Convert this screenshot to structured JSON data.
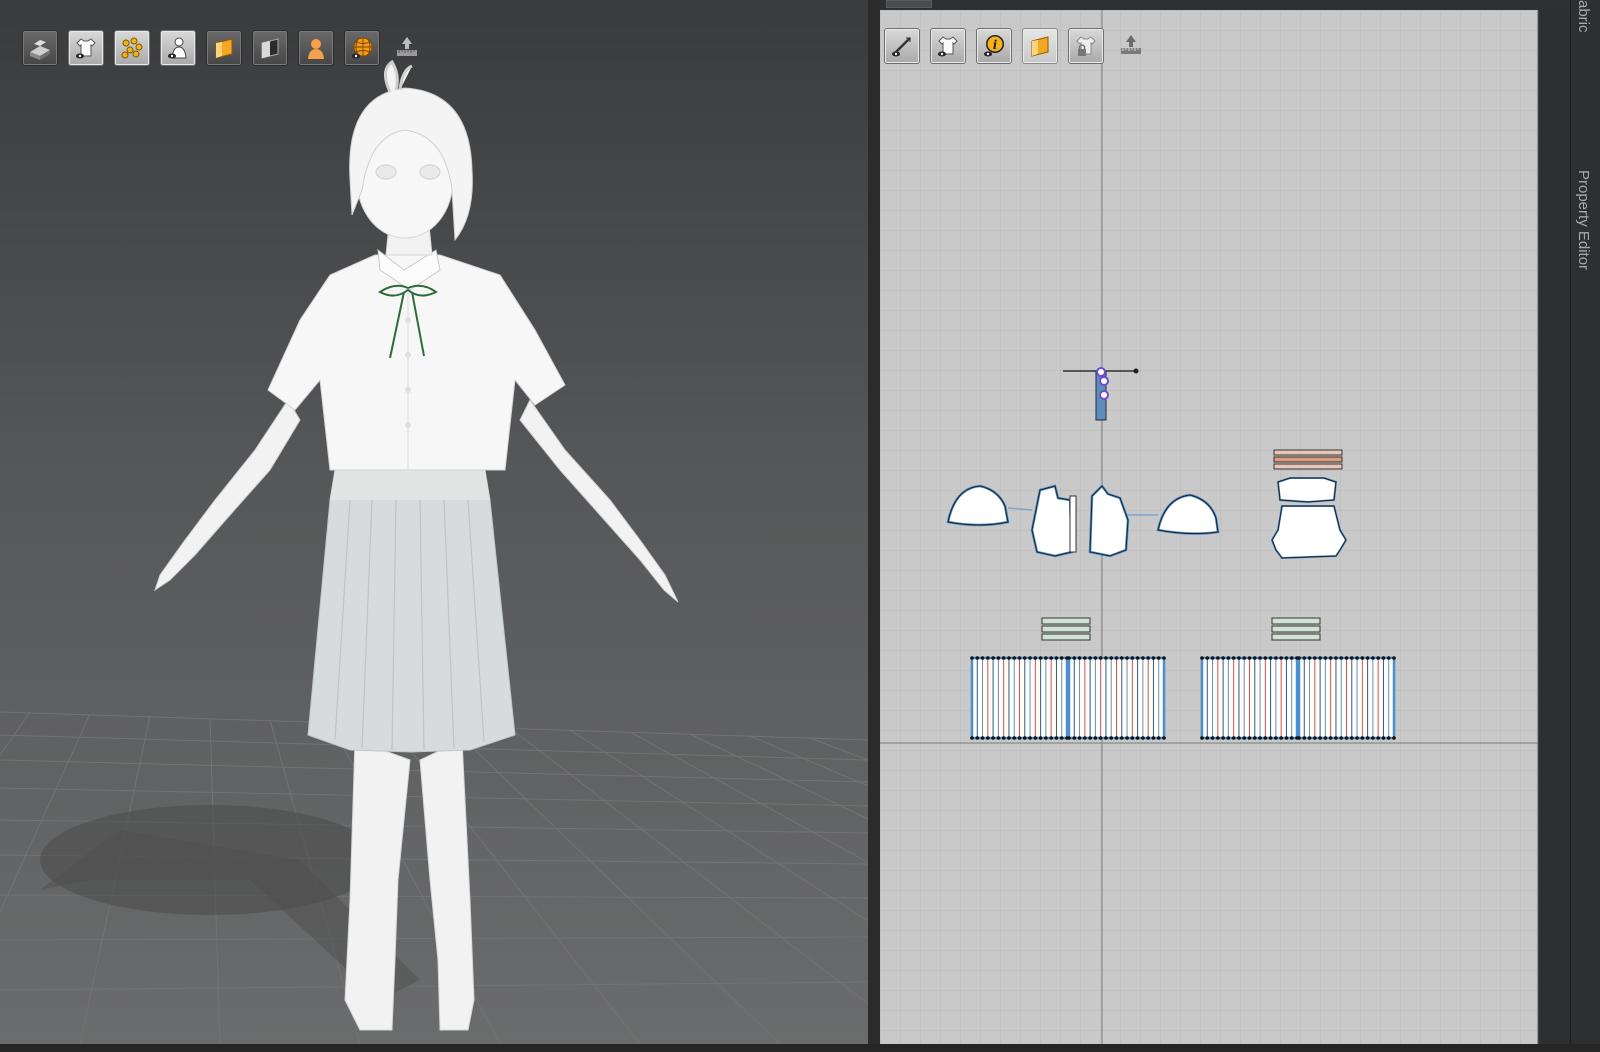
{
  "window": {
    "title": ""
  },
  "dock": {
    "top_label": "abric",
    "property_label": "Property Editor"
  },
  "viewport3d": {
    "toolbar": [
      {
        "name": "show-avatar-solid-icon"
      },
      {
        "name": "show-garment-icon"
      },
      {
        "name": "show-arrangement-points-icon"
      },
      {
        "name": "show-avatar-icon"
      },
      {
        "name": "texture-view-icon"
      },
      {
        "name": "shaded-view-icon"
      },
      {
        "name": "avatar-skin-icon"
      },
      {
        "name": "mesh-wireframe-icon"
      },
      {
        "name": "export-measure-icon"
      }
    ]
  },
  "viewport2d": {
    "toolbar": [
      {
        "name": "show-pattern-line-icon"
      },
      {
        "name": "show-garment-2d-icon"
      },
      {
        "name": "pattern-info-icon"
      },
      {
        "name": "texture-2d-icon"
      },
      {
        "name": "lock-garment-icon"
      },
      {
        "name": "measure-2d-icon"
      }
    ]
  },
  "colors": {
    "grid_bg": "#c7c7c7",
    "pattern_outline": "#3a8fd8",
    "seam_red": "#d9503f",
    "seam_green": "#6cbf8a"
  }
}
